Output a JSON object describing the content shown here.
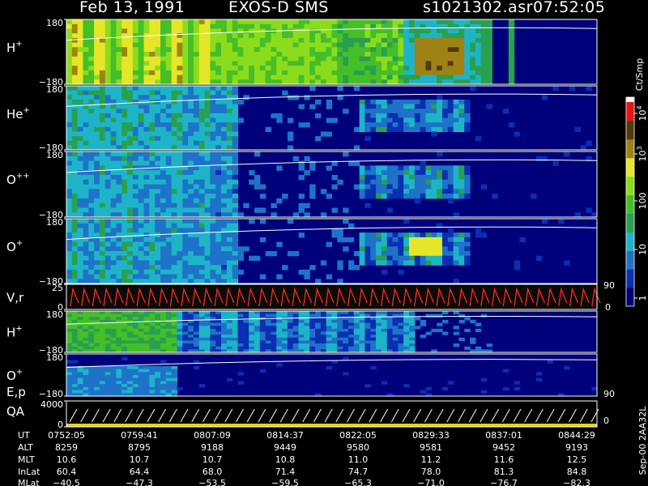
{
  "header": {
    "date": "Feb 13, 1991",
    "instrument": "EXOS-D SMS",
    "file": "s1021302.asr",
    "time": "07:52:05"
  },
  "colors": {
    "background": "#000000",
    "plot_background": "#00007a",
    "frame": "#ffffff",
    "trace": "#ffffff",
    "flux_palette": [
      "#00007a",
      "#0a2fb0",
      "#1e73c8",
      "#1eb4c8",
      "#28a050",
      "#46be28",
      "#8cdc1e",
      "#e6e628",
      "#a08214",
      "#503c0a",
      "#e61414"
    ],
    "velocity_trace": "#ff2a10",
    "qa_bar": "#e6d210"
  },
  "chart_data": {
    "type": "heatmap",
    "panels": [
      {
        "id": "H+",
        "label": "H",
        "superscript": "+",
        "yticks": [
          "180",
          "−180"
        ],
        "ylim": [
          -180,
          180
        ],
        "yaxis_meaning": "pitch angle"
      },
      {
        "id": "He+",
        "label": "He",
        "superscript": "+",
        "yticks": [
          "180",
          "−180"
        ],
        "ylim": [
          -180,
          180
        ]
      },
      {
        "id": "O++",
        "label": "O",
        "superscript": "++",
        "yticks": [
          "180",
          "−180"
        ],
        "ylim": [
          -180,
          180
        ]
      },
      {
        "id": "O+",
        "label": "O",
        "superscript": "+",
        "yticks": [
          "180",
          "−180"
        ],
        "ylim": [
          -180,
          180
        ]
      },
      {
        "id": "V,r",
        "label": "V,r",
        "superscript": "",
        "yticks": [
          "25",
          "0"
        ],
        "right_ticks": [
          "90",
          "0"
        ]
      },
      {
        "id": "H+ (low)",
        "label": "H",
        "superscript": "+",
        "yticks": [
          "180",
          "−180"
        ],
        "ylim": [
          -180,
          180
        ]
      },
      {
        "id": "O+ (low)",
        "label": "O",
        "superscript": "+",
        "yticks": [
          "180",
          "−180"
        ],
        "ylim": [
          -180,
          180
        ],
        "right_ticks": [
          "90"
        ]
      },
      {
        "id": "E,p QA",
        "label": "E,p",
        "label2": "QA",
        "superscript": "",
        "yticks": [
          "4000",
          "0"
        ],
        "right_ticks": [
          "0"
        ]
      }
    ],
    "colorbar": {
      "unit": "Ct/Smp",
      "scale": "log",
      "ticks": [
        {
          "base": "10",
          "exp": "4"
        },
        {
          "base": "10",
          "exp": "3"
        },
        {
          "base": "100",
          "exp": ""
        },
        {
          "base": "10",
          "exp": ""
        },
        {
          "base": "1",
          "exp": ""
        }
      ]
    },
    "ephemeris": {
      "labels": [
        "UT",
        "ALT",
        "MLT",
        "InLat",
        "MLat"
      ],
      "columns": [
        [
          "0752:05",
          "8259",
          "10.6",
          "60.4",
          "−40.5"
        ],
        [
          "0759:41",
          "8795",
          "10.7",
          "64.4",
          "−47.3"
        ],
        [
          "0807:09",
          "9188",
          "10.7",
          "68.0",
          "−53.5"
        ],
        [
          "0814:37",
          "9449",
          "10.8",
          "71.4",
          "−59.5"
        ],
        [
          "0822:05",
          "9580",
          "11.0",
          "74.7",
          "−65.3"
        ],
        [
          "0829:33",
          "9581",
          "11.2",
          "78.0",
          "−71.0"
        ],
        [
          "0837:01",
          "9452",
          "11.6",
          "81.3",
          "−76.7"
        ],
        [
          "0844:29",
          "9193",
          "12.5",
          "84.8",
          "−82.3"
        ]
      ]
    },
    "footer": "Sep-00  2AA32L"
  }
}
